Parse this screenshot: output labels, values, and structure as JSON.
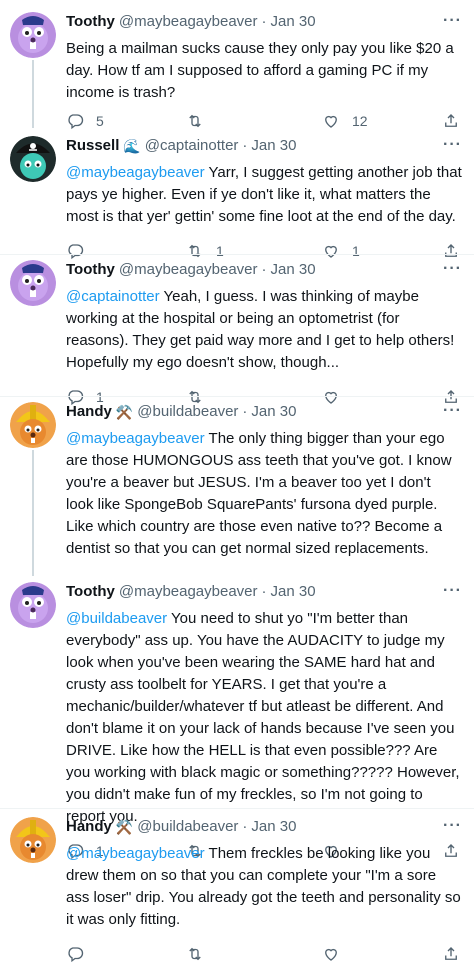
{
  "tweets": [
    {
      "name": "Toothy",
      "handle": "@maybeagaybeaver",
      "time": "Jan 30",
      "emoji": "",
      "mention": "",
      "text": "Being a mailman sucks cause they only pay you like $20 a day. How tf am I supposed to afford a gaming PC if my income is trash?",
      "replies": "5",
      "retweets": "",
      "likes": "12"
    },
    {
      "name": "Russell",
      "handle": "@captainotter",
      "time": "Jan 30",
      "emoji": "🌊",
      "mention": "@maybeagaybeaver",
      "text": " Yarr, I suggest getting another job that pays ye higher. Even if ye don't like it, what matters the most is that yer' gettin' some fine loot at the end of the day.",
      "replies": "",
      "retweets": "1",
      "likes": "1"
    },
    {
      "name": "Toothy",
      "handle": "@maybeagaybeaver",
      "time": "Jan 30",
      "emoji": "",
      "mention": "@captainotter",
      "text": " Yeah, I guess. I was thinking of maybe working at the hospital or being an optometrist (for reasons). They get paid way more and I get to help others! Hopefully my ego doesn't show, though...",
      "replies": "1",
      "retweets": "",
      "likes": ""
    },
    {
      "name": "Handy",
      "handle": "@buildabeaver",
      "time": "Jan 30",
      "emoji": "⚒️",
      "mention": "@maybeagaybeaver",
      "text": " The only thing bigger than your ego are those HUMONGOUS ass teeth that you've got. I know you're a beaver but JESUS. I'm a beaver too yet I don't look like SpongeBob SquarePants' fursona dyed purple. Like which country are those even native to?? Become a dentist so that you can get normal sized replacements.",
      "replies": "",
      "retweets": "",
      "likes": ""
    },
    {
      "name": "Toothy",
      "handle": "@maybeagaybeaver",
      "time": "Jan 30",
      "emoji": "",
      "mention": "@buildabeaver",
      "text": " You need to shut yo \"I'm better than everybody\" ass up. You have the AUDACITY to judge my look when you've been wearing the SAME hard hat and crusty ass toolbelt for YEARS. I get that you're a mechanic/builder/whatever tf but atleast be different. And don't blame it on your lack of hands because I've seen you DRIVE. Like how the HELL is that even possible??? Are you working with black magic or something????? However, you didn't make fun of my freckles, so I'm not going to report you.",
      "replies": "1",
      "retweets": "",
      "likes": ""
    },
    {
      "name": "Handy",
      "handle": "@buildabeaver",
      "time": "Jan 30",
      "emoji": "⚒️",
      "mention": "@maybeagaybeaver",
      "text": " Them freckles be looking like you drew them on so that you can complete your \"I'm a sore ass loser\" drip. You already got the teeth and personality so it was only fitting.",
      "replies": "",
      "retweets": "",
      "likes": ""
    }
  ],
  "ui": {
    "more_glyph": "···"
  },
  "colors": {
    "accent": "#1d9bf0",
    "secondary_text": "#536471",
    "divider": "#eff3f4"
  }
}
